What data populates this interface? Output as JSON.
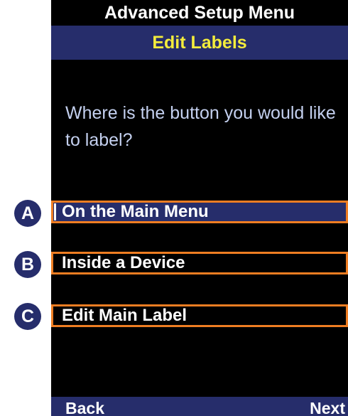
{
  "header": {
    "title": "Advanced Setup Menu",
    "subtitle": "Edit Labels"
  },
  "prompt": "Where is the button you would like to label?",
  "options": [
    {
      "badge": "A",
      "label": "On the Main Menu",
      "selected": true
    },
    {
      "badge": "B",
      "label": "Inside a Device",
      "selected": false
    },
    {
      "badge": "C",
      "label": "Edit Main Label",
      "selected": false
    }
  ],
  "footer": {
    "back_label": "Back",
    "next_label": "Next"
  },
  "colors": {
    "header_bar": "#262d6b",
    "subtitle_text": "#f3ec3c",
    "prompt_text": "#c4d0ef",
    "callout_border": "#ee7d22",
    "badge_fill": "#262d6b"
  }
}
